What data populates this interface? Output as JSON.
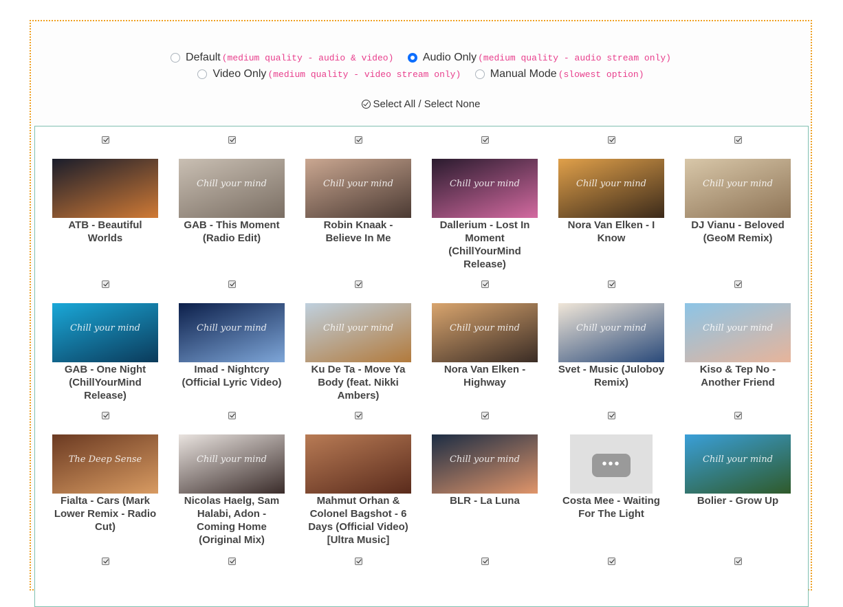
{
  "modes": [
    {
      "label": "Default",
      "hint": "(medium quality - audio & video)",
      "checked": false
    },
    {
      "label": "Audio Only",
      "hint": "(medium quality - audio stream only)",
      "checked": true
    },
    {
      "label": "Video Only",
      "hint": "(medium quality - video stream only)",
      "checked": false
    },
    {
      "label": "Manual Mode",
      "hint": "(slowest option)",
      "checked": false
    }
  ],
  "select_all_label": "Select All / Select None",
  "watermark": "Chill your mind",
  "videos": [
    {
      "title": "ATB - Beautiful Worlds",
      "checked": true,
      "thumb": [
        "#1a1d2b",
        "#d07a35"
      ],
      "watermark": false
    },
    {
      "title": "GAB - This Moment (Radio Edit)",
      "checked": true,
      "thumb": [
        "#c9bfb3",
        "#7a6e63"
      ],
      "watermark": true
    },
    {
      "title": "Robin Knaak - Believe In Me",
      "checked": true,
      "thumb": [
        "#caa791",
        "#4b3a33"
      ],
      "watermark": true
    },
    {
      "title": "Dallerium - Lost In Moment (ChillYourMind Release)",
      "checked": true,
      "thumb": [
        "#2a1b2e",
        "#d36aa0"
      ],
      "watermark": true
    },
    {
      "title": "Nora Van Elken - I Know",
      "checked": true,
      "thumb": [
        "#e0a04a",
        "#3b2a1a"
      ],
      "watermark": true
    },
    {
      "title": "DJ Vianu - Beloved (GeoM Remix)",
      "checked": true,
      "thumb": [
        "#d8c7a9",
        "#8e7456"
      ],
      "watermark": true
    },
    {
      "title": "GAB - One Night (ChillYourMind Release)",
      "checked": true,
      "thumb": [
        "#1aa8d8",
        "#0b3a5a"
      ],
      "watermark": true
    },
    {
      "title": "Imad - Nightcry (Official Lyric Video)",
      "checked": true,
      "thumb": [
        "#0c1f4a",
        "#7ea6d8"
      ],
      "watermark": true
    },
    {
      "title": "Ku De Ta - Move Ya Body (feat. Nikki Ambers)",
      "checked": true,
      "thumb": [
        "#bfd0de",
        "#b27a3c"
      ],
      "watermark": true
    },
    {
      "title": "Nora Van Elken - Highway",
      "checked": true,
      "thumb": [
        "#d9a56e",
        "#3a2c25"
      ],
      "watermark": true
    },
    {
      "title": "Svet - Music (Juloboy Remix)",
      "checked": true,
      "thumb": [
        "#f0e6d8",
        "#2a4a7a"
      ],
      "watermark": true
    },
    {
      "title": "Kiso & Tep No - Another Friend",
      "checked": true,
      "thumb": [
        "#8cc4e6",
        "#e7b49a"
      ],
      "watermark": true
    },
    {
      "title": "Fialta - Cars (Mark Lower Remix - Radio Cut)",
      "checked": true,
      "thumb": [
        "#6b3a22",
        "#d89b62"
      ],
      "watermark": true,
      "wm_text": "The Deep Sense"
    },
    {
      "title": "Nicolas Haelg, Sam Halabi, Adon - Coming Home (Original Mix)",
      "checked": true,
      "thumb": [
        "#e9e3df",
        "#3a2c2a"
      ],
      "watermark": true
    },
    {
      "title": "Mahmut Orhan & Colonel Bagshot - 6 Days (Official Video) [Ultra Music]",
      "checked": true,
      "thumb": [
        "#b87b55",
        "#5a2b1c"
      ],
      "watermark": false
    },
    {
      "title": "BLR - La Luna",
      "checked": true,
      "thumb": [
        "#1c2d44",
        "#e0956a"
      ],
      "watermark": true
    },
    {
      "title": "Costa Mee - Waiting For The Light",
      "checked": true,
      "thumb": null,
      "watermark": false
    },
    {
      "title": "Bolier - Grow Up",
      "checked": true,
      "thumb": [
        "#3a9fd8",
        "#2f5a2a"
      ],
      "watermark": true
    }
  ]
}
